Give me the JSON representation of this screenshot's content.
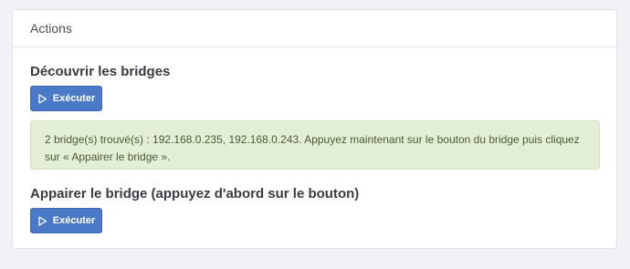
{
  "panel": {
    "title": "Actions"
  },
  "discover": {
    "title": "Découvrir les bridges",
    "button_label": "Exécuter",
    "result_message": "2 bridge(s) trouvé(s) : 192.168.0.235, 192.168.0.243. Appuyez maintenant sur le bouton du bridge puis cliquez sur « Appairer le bridge »."
  },
  "pair": {
    "title": "Appairer le bridge (appuyez d'abord sur le bouton)",
    "button_label": "Exécuter"
  },
  "icons": {
    "run": "play-icon"
  },
  "colors": {
    "button": "#4a7ac7",
    "alert_bg": "#e2efd6",
    "alert_text": "#4d5a34"
  }
}
